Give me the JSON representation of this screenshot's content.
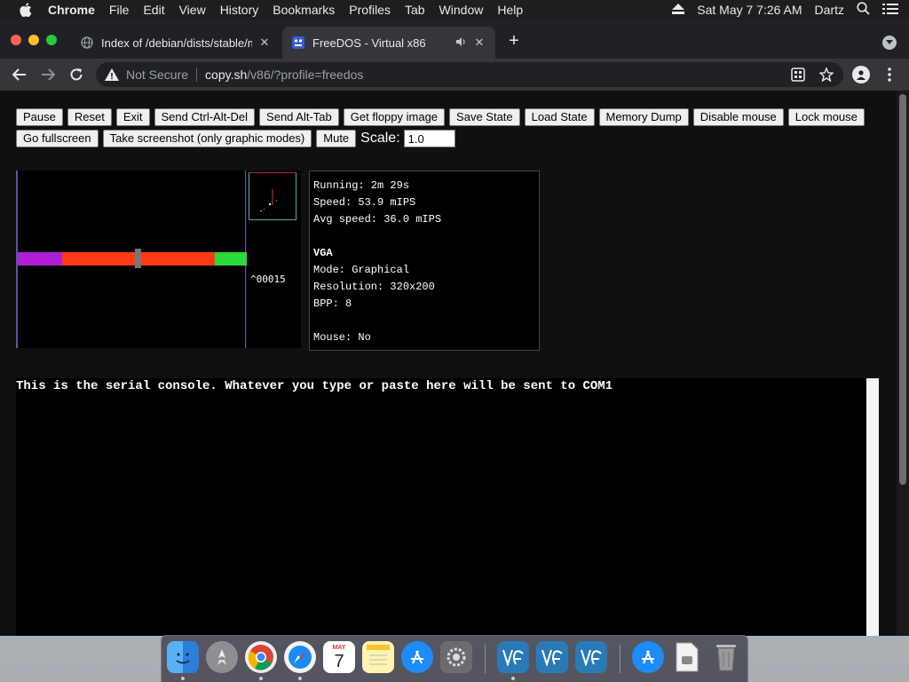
{
  "menubar": {
    "app": "Chrome",
    "items": [
      "File",
      "Edit",
      "View",
      "History",
      "Bookmarks",
      "Profiles",
      "Tab",
      "Window",
      "Help"
    ],
    "datetime": "Sat May 7  7:26 AM",
    "user": "Dartz"
  },
  "tabs": [
    {
      "title": "Index of /debian/dists/stable/m"
    },
    {
      "title": "FreeDOS - Virtual x86"
    }
  ],
  "address": {
    "security": "Not Secure",
    "host": "copy.sh",
    "path": "/v86/?profile=freedos"
  },
  "controls": {
    "row1": [
      "Pause",
      "Reset",
      "Exit",
      "Send Ctrl-Alt-Del",
      "Send Alt-Tab",
      "Get floppy image",
      "Save State",
      "Load State",
      "Memory Dump",
      "Disable mouse",
      "Lock mouse"
    ],
    "row2": [
      "Go fullscreen",
      "Take screenshot (only graphic modes)",
      "Mute"
    ],
    "scale_label": "Scale:",
    "scale_value": "1.0"
  },
  "emulator": {
    "counter": "^00015"
  },
  "stats": {
    "running": "Running: 2m 29s",
    "speed": "Speed: 53.9 mIPS",
    "avg_speed": "Avg speed: 36.0 mIPS",
    "vga_head": "VGA",
    "mode": "Mode: Graphical",
    "resolution": "Resolution: 320x200",
    "bpp": "BPP: 8",
    "mouse": "Mouse: No"
  },
  "console": {
    "text": "This is the serial console. Whatever you type or paste here will be sent to COM1"
  },
  "dock": {
    "apps": [
      "finder-icon",
      "launchpad-icon",
      "chrome-icon",
      "safari-icon",
      "calendar-icon",
      "notes-icon",
      "app-store-icon",
      "system-preferences-icon",
      "vscode-icon",
      "vscode-icon",
      "vscode-icon",
      "app-store-icon",
      "disk-image-icon",
      "trash-icon"
    ],
    "calendar_month": "MAY",
    "calendar_day": "7"
  },
  "colors": {
    "bar_purple": "#b01fd6",
    "bar_red": "#ff3a16",
    "bar_green": "#2cd93a"
  }
}
